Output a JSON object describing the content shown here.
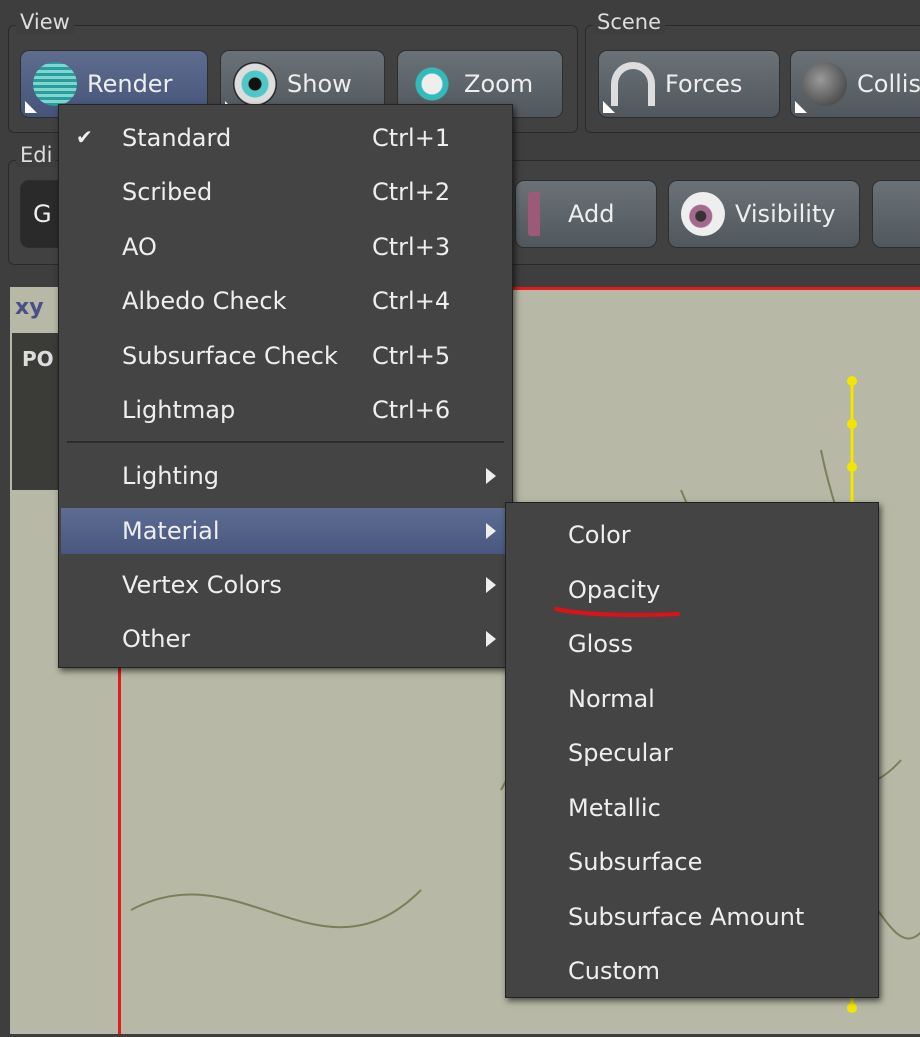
{
  "toolbar": {
    "view_label": "View",
    "scene_label": "Scene",
    "edit_label": "Edi",
    "view_buttons": [
      {
        "label": "Render",
        "icon": "globe-icon",
        "active": true
      },
      {
        "label": "Show",
        "icon": "eye-icon"
      },
      {
        "label": "Zoom",
        "icon": "magnifier-icon"
      }
    ],
    "scene_buttons": [
      {
        "label": "Forces",
        "icon": "magnet-icon"
      },
      {
        "label": "Collis",
        "icon": "bomb-icon"
      }
    ],
    "edit_buttons": [
      {
        "label": "G"
      },
      {
        "label": "Add",
        "icon": "add-branch-icon"
      },
      {
        "label": "Visibility",
        "icon": "eyeball-icon"
      }
    ]
  },
  "viewport": {
    "axis_label": "xy",
    "panel_label": "PO"
  },
  "render_menu": {
    "items": [
      {
        "label": "Standard",
        "shortcut": "Ctrl+1",
        "checked": true
      },
      {
        "label": "Scribed",
        "shortcut": "Ctrl+2"
      },
      {
        "label": "AO",
        "shortcut": "Ctrl+3"
      },
      {
        "label": "Albedo Check",
        "shortcut": "Ctrl+4"
      },
      {
        "label": "Subsurface Check",
        "shortcut": "Ctrl+5"
      },
      {
        "label": "Lightmap",
        "shortcut": "Ctrl+6"
      }
    ],
    "check_glyph": "✔",
    "submenus": [
      {
        "label": "Lighting"
      },
      {
        "label": "Material",
        "highlighted": true
      },
      {
        "label": "Vertex Colors"
      },
      {
        "label": "Other"
      }
    ]
  },
  "material_submenu": {
    "items": [
      "Color",
      "Opacity",
      "Gloss",
      "Normal",
      "Specular",
      "Metallic",
      "Subsurface",
      "Subsurface Amount",
      "Custom"
    ],
    "annotated_item": "Opacity",
    "annotation_color": "#e0101a"
  }
}
